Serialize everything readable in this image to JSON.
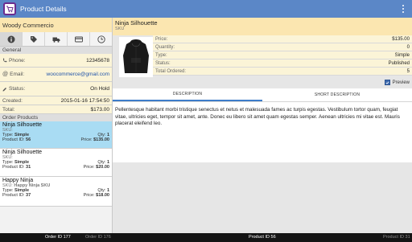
{
  "actionbar": {
    "title": "Product Details"
  },
  "customer": {
    "name": "Woody Commercio"
  },
  "sections": {
    "general": "General",
    "order_products": "Order Products"
  },
  "info": {
    "phone": {
      "label": "Phone:",
      "value": "12345678"
    },
    "email": {
      "label": "Email:",
      "value": "woocommerce@gmail.com"
    },
    "status": {
      "label": "Status:",
      "value": "On Hold"
    },
    "created": {
      "label": "Created:",
      "value": "2015-01-16 17:54:50"
    },
    "total": {
      "label": "Total:",
      "value": "$173.00"
    }
  },
  "order_products": [
    {
      "name": "Ninja Silhouette",
      "sku_label": "SKU:",
      "sku": "",
      "type_label": "Type:",
      "type": "Simple",
      "qty_label": "Qty:",
      "qty": "1",
      "id_label": "Product ID:",
      "id": "56",
      "price_label": "Price:",
      "price": "$135.00",
      "selected": true
    },
    {
      "name": "Ninja Silhouette",
      "sku_label": "SKU:",
      "sku": "",
      "type_label": "Type:",
      "type": "Simple",
      "qty_label": "Qty:",
      "qty": "1",
      "id_label": "Product ID:",
      "id": "31",
      "price_label": "Price:",
      "price": "$20.00",
      "selected": false
    },
    {
      "name": "Happy Ninja",
      "sku_label": "SKU:",
      "sku": "Happy Ninja SKU",
      "type_label": "Type:",
      "type": "Simple",
      "qty_label": "Qty:",
      "qty": "1",
      "id_label": "Product ID:",
      "id": "37",
      "price_label": "Price:",
      "price": "$18.00",
      "selected": false
    }
  ],
  "product": {
    "title": "Ninja Silhouette",
    "sku_label": "SKU",
    "attributes": [
      {
        "label": "Price:",
        "value": "$135.00"
      },
      {
        "label": "Quantity:",
        "value": "0"
      },
      {
        "label": "Type:",
        "value": "Simple"
      },
      {
        "label": "Status:",
        "value": "Published"
      },
      {
        "label": "Total Ordered:",
        "value": "5"
      }
    ],
    "preview_label": "Preview",
    "preview_checked": true,
    "tabs": [
      "DESCRIPTION",
      "SHORT DESCRIPTION"
    ],
    "description": "Pellentesque habitant morbi tristique senectus et netus et malesuada fames ac turpis egestas. Vestibulum tortor quam, feugiat vitae, ultricies eget, tempor sit amet, ante. Donec eu libero sit amet quam egestas semper. Aenean ultricies mi vitae est. Mauris placerat eleifend leo."
  },
  "bottom_bar": {
    "order_current": "Order ID 177",
    "order_next": "Order ID 176",
    "product_current": "Product ID 56",
    "product_next": "Product ID 31"
  },
  "colors": {
    "actionbar": "#5b87c7",
    "header": "#fbe6b0",
    "selected_row": "#a9dcf3",
    "accent": "#3d7cc9"
  }
}
